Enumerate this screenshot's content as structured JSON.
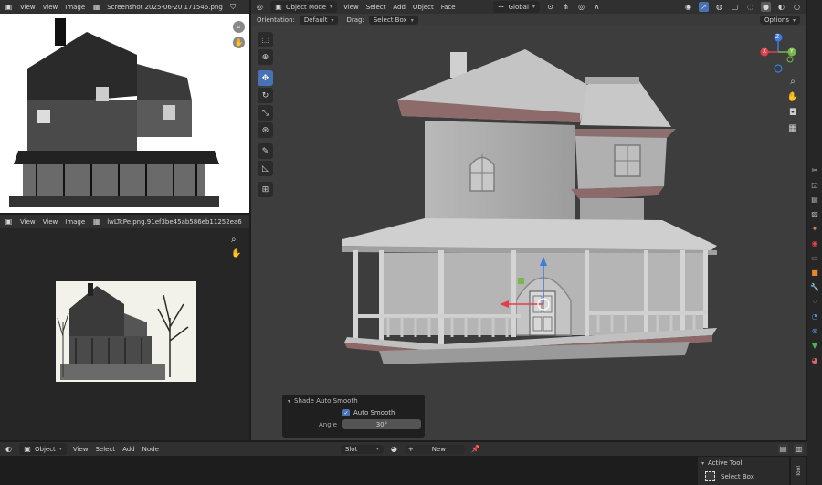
{
  "image_editor_top": {
    "menus": [
      "View",
      "View",
      "Image"
    ],
    "filename": "Screenshot 2025-06-20 171546.png"
  },
  "image_editor_bottom": {
    "menus": [
      "View",
      "View",
      "Image"
    ],
    "filename": "lwLTcPe.png.91ef3be45ab586eb11252ea6"
  },
  "viewport_header": {
    "mode": "Object Mode",
    "menus": [
      "View",
      "Select",
      "Add",
      "Object",
      "Face"
    ],
    "transform_orientation": "Global"
  },
  "tool_settings": {
    "orientation_label": "Orientation:",
    "orientation_value": "Default",
    "drag_label": "Drag:",
    "drag_value": "Select Box",
    "options_label": "Options"
  },
  "gizmo": {
    "x": "X",
    "y": "Y",
    "z": "Z"
  },
  "operator_panel": {
    "title": "Shade Auto Smooth",
    "checkbox_label": "Auto Smooth",
    "checkbox_checked": true,
    "angle_label": "Angle",
    "angle_value": "30°"
  },
  "node_editor_header": {
    "type": "Object",
    "menus": [
      "View",
      "Select",
      "Add",
      "Node"
    ],
    "slot": "Slot",
    "new_label": "New"
  },
  "active_tool_panel": {
    "title": "Active Tool",
    "tool_name": "Select Box",
    "tab_label": "Tool"
  },
  "colors": {
    "accent_blue": "#4772b3",
    "axis_x": "#e0404a",
    "axis_y": "#7ab648",
    "axis_z": "#3d7ce0",
    "viewport_bg": "#3d3d3d",
    "panel_bg": "#303030",
    "image_editor_bg": "#262626"
  },
  "icons": [
    "cursor-icon",
    "move-icon",
    "rotate-icon",
    "scale-icon",
    "transform-icon",
    "annotate-icon",
    "measure-icon",
    "add-cube-icon",
    "zoom-icon",
    "hand-icon",
    "camera-icon",
    "grid-icon"
  ]
}
